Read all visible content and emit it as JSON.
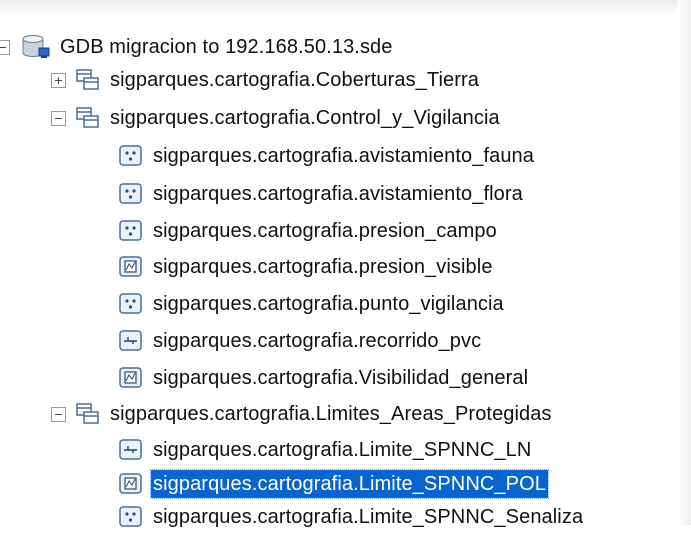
{
  "tree": {
    "root": {
      "label": "GDB migracion  to 192.168.50.13.sde",
      "icon": "database-icon"
    },
    "datasets": [
      {
        "label": "sigparques.cartografia.Coberturas_Tierra",
        "icon": "feature-dataset-icon",
        "expanded": false
      },
      {
        "label": "sigparques.cartografia.Control_y_Vigilancia",
        "icon": "feature-dataset-icon",
        "expanded": true,
        "children": [
          {
            "label": "sigparques.cartografia.avistamiento_fauna",
            "icon": "point-feature-class-icon"
          },
          {
            "label": "sigparques.cartografia.avistamiento_flora",
            "icon": "point-feature-class-icon"
          },
          {
            "label": "sigparques.cartografia.presion_campo",
            "icon": "point-feature-class-icon"
          },
          {
            "label": "sigparques.cartografia.presion_visible",
            "icon": "polygon-feature-class-icon"
          },
          {
            "label": "sigparques.cartografia.punto_vigilancia",
            "icon": "point-feature-class-icon"
          },
          {
            "label": "sigparques.cartografia.recorrido_pvc",
            "icon": "line-feature-class-icon"
          },
          {
            "label": "sigparques.cartografia.Visibilidad_general",
            "icon": "polygon-feature-class-icon"
          }
        ]
      },
      {
        "label": "sigparques.cartografia.Limites_Areas_Protegidas",
        "icon": "feature-dataset-icon",
        "expanded": true,
        "children": [
          {
            "label": "sigparques.cartografia.Limite_SPNNC_LN",
            "icon": "line-feature-class-icon"
          },
          {
            "label": "sigparques.cartografia.Limite_SPNNC_POL",
            "icon": "polygon-feature-class-icon",
            "selected": true
          },
          {
            "label": "sigparques.cartografia.Limite_SPNNC_Senaliza",
            "icon": "point-feature-class-icon"
          }
        ]
      }
    ]
  },
  "colors": {
    "selection": "#0a64d0",
    "text": "#111111",
    "icon_stroke": "#4a6e96",
    "icon_fill": "#eaf2fb"
  }
}
